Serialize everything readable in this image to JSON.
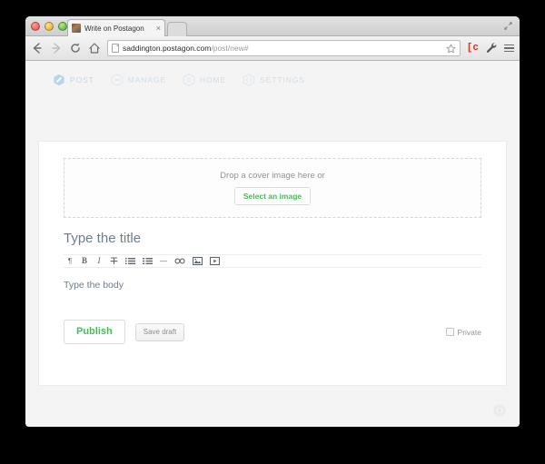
{
  "browser": {
    "window_controls": [
      "close",
      "minimize",
      "zoom"
    ],
    "tab": {
      "title": "Write on Postagon",
      "close_label": "×",
      "favicon_name": "site-favicon"
    },
    "new_tab_label": "",
    "back_label": "←",
    "forward_label": "→",
    "reload_label": "C",
    "home_label": "⌂",
    "url": {
      "host": "saddington.postagon.com",
      "path": "/post/new#"
    },
    "bookmark_label": "☆",
    "extension_label": "[c",
    "wrench_label": "wrench",
    "menu_label": "menu"
  },
  "app": {
    "nav": [
      {
        "label": "POST",
        "icon": "pencil-hexagon-icon",
        "active": true
      },
      {
        "label": "MANAGE",
        "icon": "bars-hexagon-icon",
        "active": false
      },
      {
        "label": "HOME",
        "icon": "circle-hexagon-icon",
        "active": false
      },
      {
        "label": "SETTINGS",
        "icon": "chevrons-hexagon-icon",
        "active": false
      }
    ],
    "cover": {
      "drop_text": "Drop a cover image here or",
      "select_button": "Select an image"
    },
    "editor": {
      "title_placeholder": "Type the title",
      "body_placeholder": "Type the body",
      "toolbar": [
        {
          "name": "paragraph-icon",
          "glyph": "¶"
        },
        {
          "name": "bold-icon",
          "glyph": "B"
        },
        {
          "name": "italic-icon",
          "glyph": "I"
        },
        {
          "name": "strikethrough-icon",
          "glyph": "T"
        },
        {
          "name": "unordered-list-icon",
          "glyph": "list"
        },
        {
          "name": "ordered-list-icon",
          "glyph": "numlist"
        },
        {
          "name": "horizontal-rule-icon",
          "glyph": "—"
        },
        {
          "name": "link-icon",
          "glyph": "link"
        },
        {
          "name": "image-icon",
          "glyph": "image"
        },
        {
          "name": "video-icon",
          "glyph": "video"
        }
      ]
    },
    "actions": {
      "publish": "Publish",
      "save_draft": "Save draft",
      "private": "Private",
      "private_checked": false
    },
    "badge_icon": "postagon-hexagon-icon"
  },
  "colors": {
    "accent_green": "#4cbb5c",
    "nav_blue": "#c3d7e8",
    "text_slate": "#6e7d8c",
    "page_bg": "#f4f4f4",
    "extension_red": "#e0301e"
  }
}
